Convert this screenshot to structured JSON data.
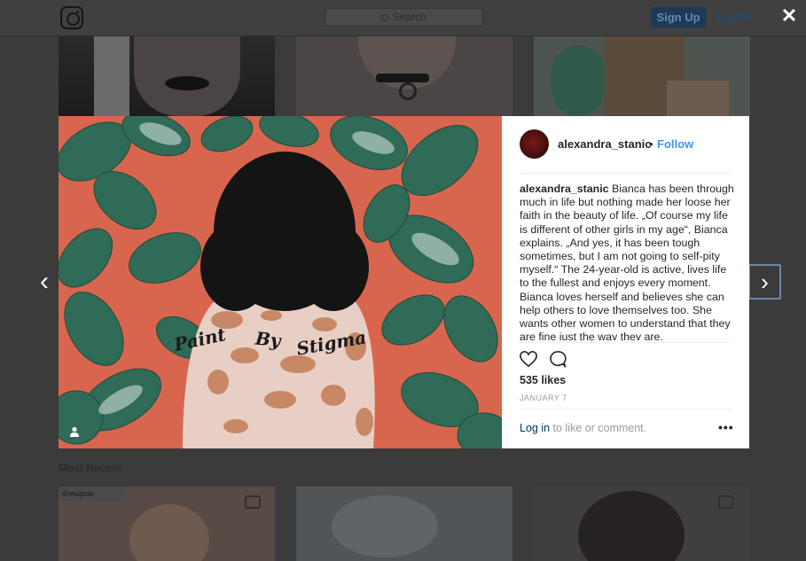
{
  "header": {
    "search_placeholder": "Search",
    "signup_label": "Sign Up",
    "login_label": "Log In"
  },
  "feed": {
    "section_label": "Most Recent",
    "repost_tag": "drewpsie"
  },
  "modal": {
    "close_glyph": "✕",
    "prev_glyph": "‹",
    "next_glyph": "›",
    "photo_overlay_words": [
      "Paint",
      "By",
      "Stigma"
    ],
    "author": {
      "username": "alexandra_stanic",
      "separator": "•",
      "follow_label": "Follow"
    },
    "caption": {
      "username": "alexandra_stanic",
      "text": " Bianca has been through much in life but nothing made her loose her faith in the beauty of life. „Of course my life is different of other girls in my age“, Bianca explains. „And yes, it has been tough sometimes, but I am not going to self-pity myself.“ The 24-year-old is active, lives life to the fullest and enjoys every moment. Bianca loves herself and believes she can help others to love themselves too. She wants other women to understand that they are fine just the way they are."
    },
    "likes": "535 likes",
    "date": "JANUARY 7",
    "login_link": "Log in",
    "login_suffix": " to like or comment.",
    "more_glyph": "•••",
    "icons": [
      "heart-icon",
      "comment-icon",
      "user-tag-icon"
    ]
  },
  "colors": {
    "link_blue": "#3897f0",
    "photo_bg": "#d8664e",
    "leaf_green": "#2f6b57"
  }
}
